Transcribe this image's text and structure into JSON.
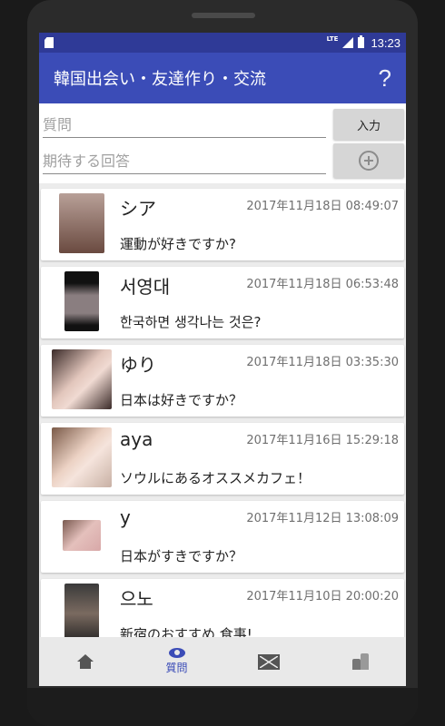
{
  "status_bar": {
    "network": "LTE",
    "time": "13:23"
  },
  "app_bar": {
    "title": "韓国出会い・友達作り・交流",
    "help_label": "?"
  },
  "form": {
    "question_placeholder": "質問",
    "answer_placeholder": "期待する回答",
    "submit_label": "入力"
  },
  "posts": [
    {
      "name": "シア",
      "date": "2017年11月18日 08:49:07",
      "question": "運動が好きですか?",
      "avatar_color": "#8a6a5a"
    },
    {
      "name": "서영대",
      "date": "2017年11月18日 06:53:48",
      "question": "한국하면 생각나는 것은?",
      "avatar_color": "#1e1e1e"
    },
    {
      "name": "ゆり",
      "date": "2017年11月18日 03:35:30",
      "question": "日本は好きですか？",
      "avatar_color": "#c9a79b"
    },
    {
      "name": "aya",
      "date": "2017年11月16日 15:29:18",
      "question": "ソウルにあるオススメカフェ！",
      "avatar_color": "#d9b8a8"
    },
    {
      "name": "y",
      "date": "2017年11月12日 13:08:09",
      "question": "日本がすきですか？",
      "avatar_color": "#cfa6a6"
    },
    {
      "name": "으노",
      "date": "2017年11月10日 20:00:20",
      "question": "新宿のおすすめ 食事!",
      "avatar_color": "#4a4a4a"
    }
  ],
  "tab_bar": {
    "home_icon": "home-icon",
    "questions_label": "質問",
    "mail_icon": "mail-icon",
    "profile_icon": "profile-icon"
  },
  "colors": {
    "primary": "#3b4cb7",
    "status_bar": "#2f3a97",
    "background": "#ececec"
  }
}
